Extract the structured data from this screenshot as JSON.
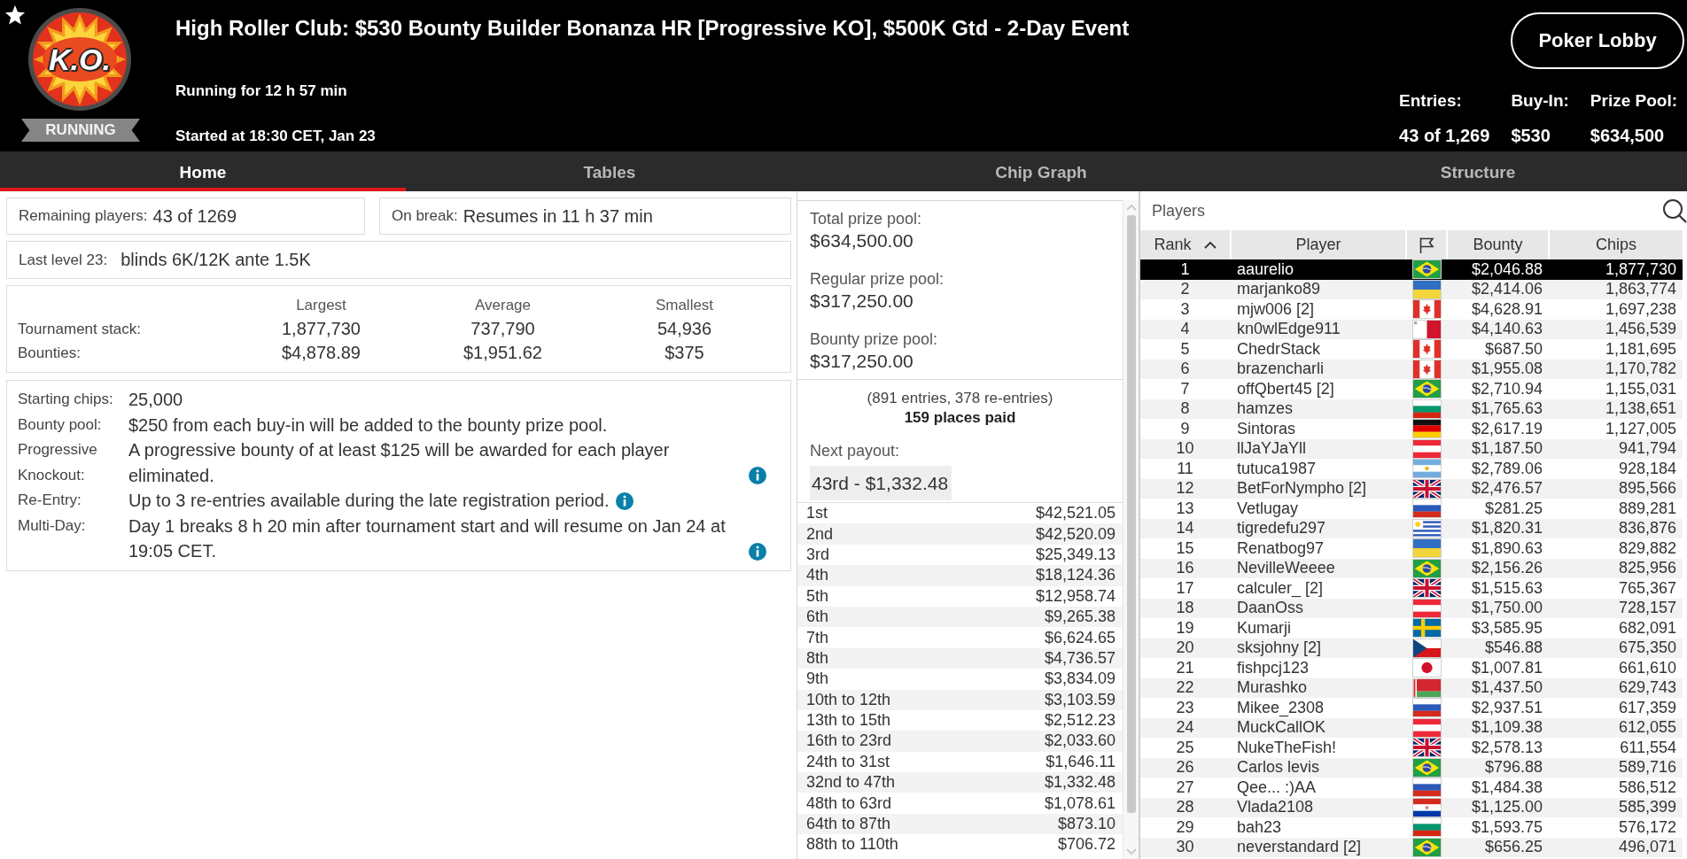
{
  "header": {
    "logo_text": "K.O.",
    "status": "RUNNING",
    "title": "High Roller Club: $530 Bounty Builder Bonanza HR [Progressive KO], $500K Gtd - 2-Day Event",
    "running_for": "Running for 12 h 57 min",
    "started_at": "Started at 18:30 CET, Jan 23",
    "lobby_button": "Poker Lobby",
    "stats": [
      {
        "label": "Entries:",
        "value": "43 of 1,269"
      },
      {
        "label": "Buy-In:",
        "value": "$530"
      },
      {
        "label": "Prize Pool:",
        "value": "$634,500"
      }
    ]
  },
  "tabs": [
    {
      "label": "Home",
      "selected": true
    },
    {
      "label": "Tables",
      "selected": false
    },
    {
      "label": "Chip Graph",
      "selected": false
    },
    {
      "label": "Structure",
      "selected": false
    }
  ],
  "summary": {
    "remaining": {
      "label": "Remaining players:",
      "value": "43 of 1269"
    },
    "break": {
      "label": "On break:",
      "value": "Resumes in 11 h 37 min"
    },
    "last_level": {
      "label": "Last level 23:",
      "value": "blinds 6K/12K ante 1.5K"
    }
  },
  "stacks": {
    "columns": [
      "Largest",
      "Average",
      "Smallest"
    ],
    "rows": [
      {
        "label": "Tournament stack:",
        "values": [
          "1,877,730",
          "737,790",
          "54,936"
        ]
      },
      {
        "label": "Bounties:",
        "values": [
          "$4,878.89",
          "$1,951.62",
          "$375"
        ]
      }
    ]
  },
  "details": [
    {
      "label": "Starting chips:",
      "text": "25,000",
      "info": false
    },
    {
      "label": "Bounty pool:",
      "text": "$250 from each buy-in will be added to the bounty prize pool.",
      "info": false
    },
    {
      "label": "Progressive Knockout:",
      "text": "A progressive bounty of at least $125 will be awarded for each player eliminated.",
      "info": true
    },
    {
      "label": "Re-Entry:",
      "text": "Up to 3 re-entries available during the late registration period.",
      "info": true
    },
    {
      "label": "Multi-Day:",
      "text": "Day 1 breaks 8 h 20 min after tournament start and will resume on Jan 24 at 19:05 CET.",
      "info": true
    }
  ],
  "prizes": {
    "pools": [
      {
        "label": "Total prize pool:",
        "value": "$634,500.00"
      },
      {
        "label": "Regular prize pool:",
        "value": "$317,250.00"
      },
      {
        "label": "Bounty prize pool:",
        "value": "$317,250.00"
      }
    ],
    "entries_note": "(891 entries, 378 re-entries)",
    "places_paid": "159 places paid",
    "next_payout": {
      "label": "Next payout:",
      "value": "43rd - $1,332.48"
    },
    "payouts": [
      {
        "place": "1st",
        "amount": "$42,521.05"
      },
      {
        "place": "2nd",
        "amount": "$42,520.09"
      },
      {
        "place": "3rd",
        "amount": "$25,349.13"
      },
      {
        "place": "4th",
        "amount": "$18,124.36"
      },
      {
        "place": "5th",
        "amount": "$12,958.74"
      },
      {
        "place": "6th",
        "amount": "$9,265.38"
      },
      {
        "place": "7th",
        "amount": "$6,624.65"
      },
      {
        "place": "8th",
        "amount": "$4,736.57"
      },
      {
        "place": "9th",
        "amount": "$3,834.09"
      },
      {
        "place": "10th to 12th",
        "amount": "$3,103.59"
      },
      {
        "place": "13th to 15th",
        "amount": "$2,512.23"
      },
      {
        "place": "16th to 23rd",
        "amount": "$2,033.60"
      },
      {
        "place": "24th to 31st",
        "amount": "$1,646.11"
      },
      {
        "place": "32nd to 47th",
        "amount": "$1,332.48"
      },
      {
        "place": "48th to 63rd",
        "amount": "$1,078.61"
      },
      {
        "place": "64th to 87th",
        "amount": "$873.10"
      },
      {
        "place": "88th to 110th",
        "amount": "$706.72"
      }
    ]
  },
  "players": {
    "title": "Players",
    "columns": [
      {
        "kind": "text",
        "label": "Rank",
        "sorted": true
      },
      {
        "kind": "text",
        "label": "Player",
        "sorted": false
      },
      {
        "kind": "icon",
        "sorted": false
      },
      {
        "kind": "text",
        "label": "Bounty",
        "sorted": false
      },
      {
        "kind": "text",
        "label": "Chips",
        "sorted": false
      }
    ],
    "rows": [
      {
        "rank": "1",
        "player": "aaurelio",
        "flag": {
          "kind": "brazil"
        },
        "bounty": "$2,046.88",
        "chips": "1,877,730",
        "selected": true
      },
      {
        "rank": "2",
        "player": "marjanko89",
        "flag": {
          "kind": "ukraine"
        },
        "bounty": "$2,414.06",
        "chips": "1,863,774",
        "selected": false
      },
      {
        "rank": "3",
        "player": "mjw006 [2]",
        "flag": {
          "kind": "canada"
        },
        "bounty": "$4,628.91",
        "chips": "1,697,238",
        "selected": false
      },
      {
        "rank": "4",
        "player": "kn0wlEdge911",
        "flag": {
          "kind": "malta"
        },
        "bounty": "$4,140.63",
        "chips": "1,456,539",
        "selected": false
      },
      {
        "rank": "5",
        "player": "ChedrStack",
        "flag": {
          "kind": "canada"
        },
        "bounty": "$687.50",
        "chips": "1,181,695",
        "selected": false
      },
      {
        "rank": "6",
        "player": "brazencharli",
        "flag": {
          "kind": "canada"
        },
        "bounty": "$1,955.08",
        "chips": "1,170,782",
        "selected": false
      },
      {
        "rank": "7",
        "player": "offQbert45 [2]",
        "flag": {
          "kind": "brazil"
        },
        "bounty": "$2,710.94",
        "chips": "1,155,031",
        "selected": false
      },
      {
        "rank": "8",
        "player": "hamzes",
        "flag": {
          "kind": "bulgaria"
        },
        "bounty": "$1,765.63",
        "chips": "1,138,651",
        "selected": false
      },
      {
        "rank": "9",
        "player": "Sintoras",
        "flag": {
          "kind": "germany"
        },
        "bounty": "$2,617.19",
        "chips": "1,127,005",
        "selected": false
      },
      {
        "rank": "10",
        "player": "llJaYJaYll",
        "flag": {
          "kind": "austria"
        },
        "bounty": "$1,187.50",
        "chips": "941,794",
        "selected": false
      },
      {
        "rank": "11",
        "player": "tutuca1987",
        "flag": {
          "kind": "argentina"
        },
        "bounty": "$2,789.06",
        "chips": "928,184",
        "selected": false
      },
      {
        "rank": "12",
        "player": "BetForNympho [2]",
        "flag": {
          "kind": "uk"
        },
        "bounty": "$2,476.57",
        "chips": "895,566",
        "selected": false
      },
      {
        "rank": "13",
        "player": "Vetlugay",
        "flag": {
          "kind": "russia"
        },
        "bounty": "$281.25",
        "chips": "889,281",
        "selected": false
      },
      {
        "rank": "14",
        "player": "tigredefu297",
        "flag": {
          "kind": "uruguay"
        },
        "bounty": "$1,820.31",
        "chips": "836,876",
        "selected": false
      },
      {
        "rank": "15",
        "player": "Renatbog97",
        "flag": {
          "kind": "ukraine"
        },
        "bounty": "$1,890.63",
        "chips": "829,882",
        "selected": false
      },
      {
        "rank": "16",
        "player": "NevilleWeeee",
        "flag": {
          "kind": "brazil"
        },
        "bounty": "$2,156.26",
        "chips": "825,956",
        "selected": false
      },
      {
        "rank": "17",
        "player": "calculer_ [2]",
        "flag": {
          "kind": "uk"
        },
        "bounty": "$1,515.63",
        "chips": "765,367",
        "selected": false
      },
      {
        "rank": "18",
        "player": "DaanOss",
        "flag": {
          "kind": "austria"
        },
        "bounty": "$1,750.00",
        "chips": "728,157",
        "selected": false
      },
      {
        "rank": "19",
        "player": "Kumarji",
        "flag": {
          "kind": "sweden"
        },
        "bounty": "$3,585.95",
        "chips": "682,091",
        "selected": false
      },
      {
        "rank": "20",
        "player": "sksjohny [2]",
        "flag": {
          "kind": "czech"
        },
        "bounty": "$546.88",
        "chips": "675,350",
        "selected": false
      },
      {
        "rank": "21",
        "player": "fishpcj123",
        "flag": {
          "kind": "japan"
        },
        "bounty": "$1,007.81",
        "chips": "661,610",
        "selected": false
      },
      {
        "rank": "22",
        "player": "Murashko",
        "flag": {
          "kind": "belarus"
        },
        "bounty": "$1,437.50",
        "chips": "629,743",
        "selected": false
      },
      {
        "rank": "23",
        "player": "Mikee_2308",
        "flag": {
          "kind": "russia"
        },
        "bounty": "$2,937.51",
        "chips": "617,359",
        "selected": false
      },
      {
        "rank": "24",
        "player": "MuckCallOK",
        "flag": {
          "kind": "austria"
        },
        "bounty": "$1,109.38",
        "chips": "612,055",
        "selected": false
      },
      {
        "rank": "25",
        "player": "NukeTheFish!",
        "flag": {
          "kind": "uk"
        },
        "bounty": "$2,578.13",
        "chips": "611,554",
        "selected": false
      },
      {
        "rank": "26",
        "player": "Carlos levis",
        "flag": {
          "kind": "brazil"
        },
        "bounty": "$796.88",
        "chips": "589,716",
        "selected": false
      },
      {
        "rank": "27",
        "player": "Qee... :)AA",
        "flag": {
          "kind": "russia"
        },
        "bounty": "$1,484.38",
        "chips": "586,512",
        "selected": false
      },
      {
        "rank": "28",
        "player": "Vlada2108",
        "flag": {
          "kind": "paraguay"
        },
        "bounty": "$1,125.00",
        "chips": "585,399",
        "selected": false
      },
      {
        "rank": "29",
        "player": "bah23",
        "flag": {
          "kind": "bulgaria"
        },
        "bounty": "$1,593.75",
        "chips": "576,172",
        "selected": false
      },
      {
        "rank": "30",
        "player": "neverstandard [2]",
        "flag": {
          "kind": "brazil"
        },
        "bounty": "$656.25",
        "chips": "496,071",
        "selected": false
      }
    ]
  }
}
